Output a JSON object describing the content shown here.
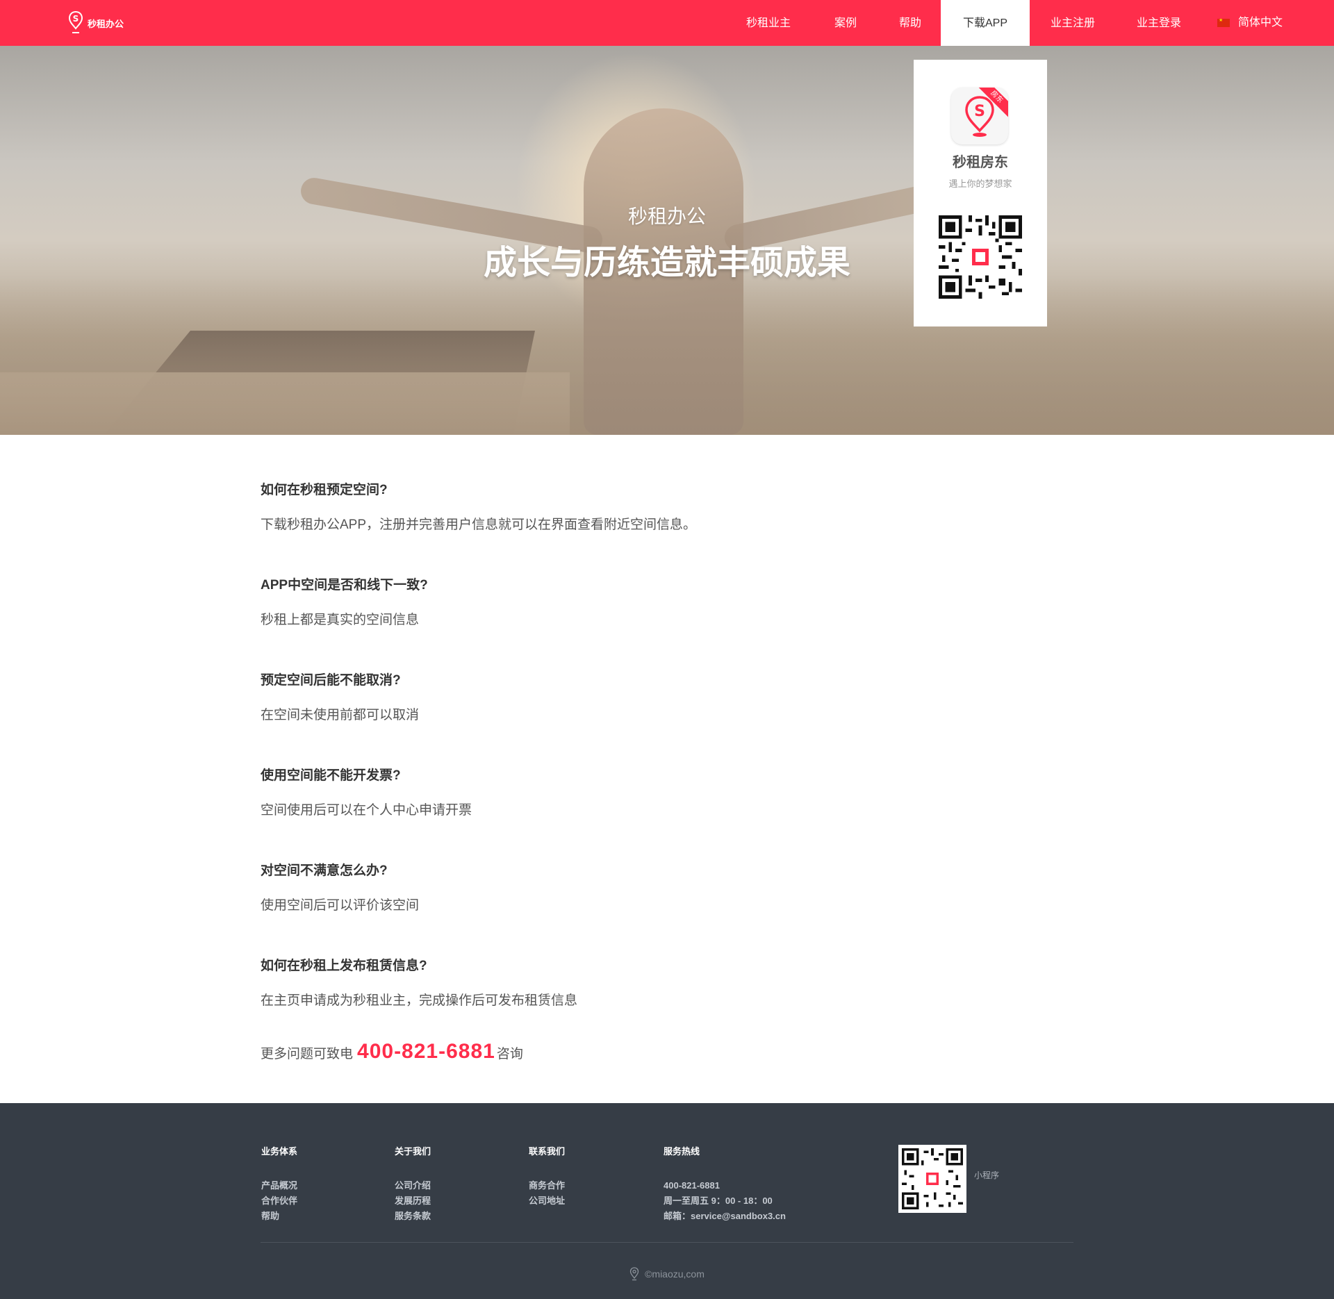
{
  "brand": {
    "name": "秒租办公",
    "accent": "#ff2d4b",
    "footer_bg": "#363d46"
  },
  "nav": {
    "items": [
      {
        "label": "秒租业主",
        "active": false
      },
      {
        "label": "案例",
        "active": false
      },
      {
        "label": "帮助",
        "active": false
      },
      {
        "label": "下载APP",
        "active": true
      },
      {
        "label": "业主注册",
        "active": false
      },
      {
        "label": "业主登录",
        "active": false
      }
    ],
    "language": "简体中文",
    "language_flag_icon": "china-flag-icon"
  },
  "hero": {
    "subtitle": "秒租办公",
    "title": "成长与历练造就丰硕成果"
  },
  "download_card": {
    "ribbon": "房东",
    "app_name": "秒租房东",
    "slogan": "遇上你的梦想家"
  },
  "faq": [
    {
      "q": "如何在秒租预定空间?",
      "a": "下载秒租办公APP，注册并完善用户信息就可以在界面查看附近空间信息。"
    },
    {
      "q": "APP中空间是否和线下一致?",
      "a": "秒租上都是真实的空间信息"
    },
    {
      "q": "预定空间后能不能取消?",
      "a": "在空间未使用前都可以取消"
    },
    {
      "q": "使用空间能不能开发票?",
      "a": "空间使用后可以在个人中心申请开票"
    },
    {
      "q": "对空间不满意怎么办?",
      "a": "使用空间后可以评价该空间"
    },
    {
      "q": "如何在秒租上发布租赁信息?",
      "a": "在主页申请成为秒租业主，完成操作后可发布租赁信息"
    }
  ],
  "more": {
    "prefix": "更多问题可致电",
    "phone": "400-821-6881",
    "suffix": "咨询"
  },
  "footer": {
    "columns": [
      {
        "title": "业务体系",
        "links": [
          "产品概况",
          "合作伙伴",
          "帮助"
        ]
      },
      {
        "title": "关于我们",
        "links": [
          "公司介绍",
          "发展历程",
          "服务条款"
        ]
      },
      {
        "title": "联系我们",
        "links": [
          "商务合作",
          "公司地址"
        ]
      },
      {
        "title": "服务热线",
        "links": [
          "400-821-6881",
          "周一至周五 9：00 - 18：00",
          "邮箱：service@sandbox3.cn"
        ]
      }
    ],
    "qr_label": "小程序",
    "copyright": "©miaozu,com"
  }
}
